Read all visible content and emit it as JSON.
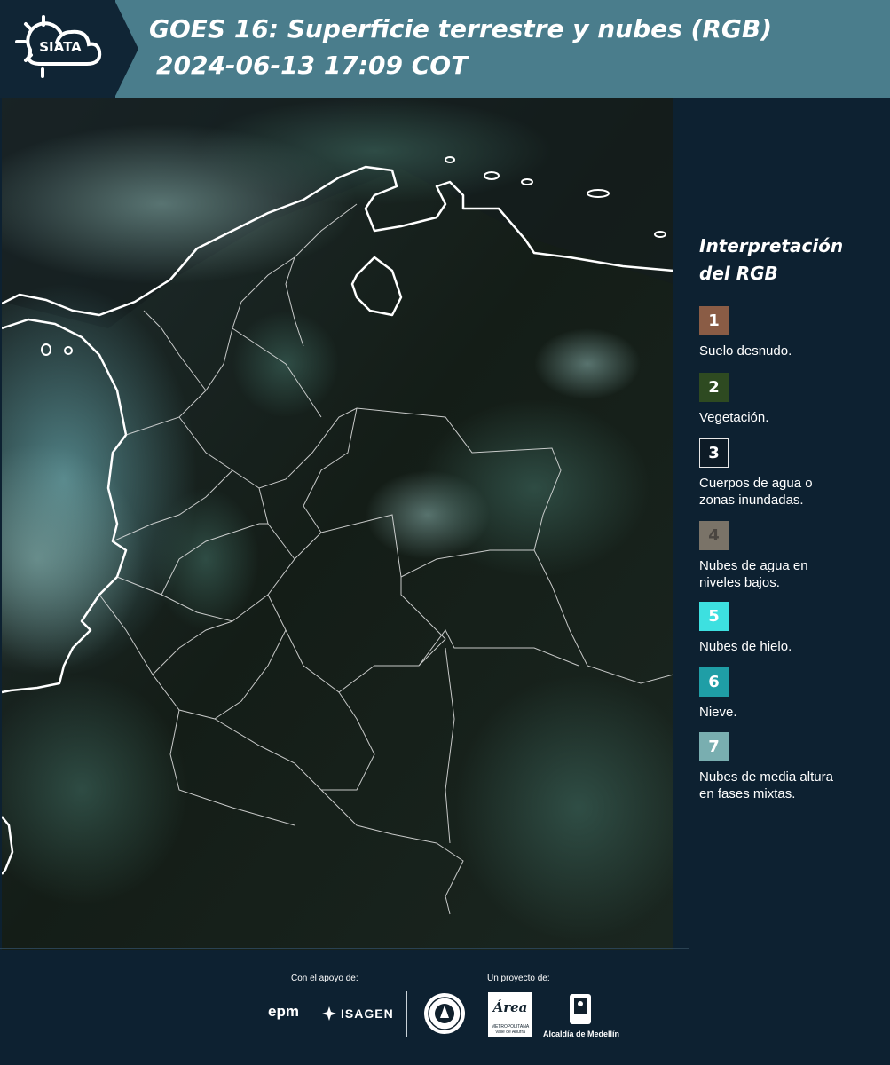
{
  "header": {
    "logo_text": "SIATA",
    "title_line1": "GOES 16: Superficie terrestre y nubes (RGB)",
    "title_line2": "2024-06-13 17:09 COT",
    "background_color": "#4a7d8c",
    "logo_background_color": "#102535"
  },
  "map": {
    "icon": "satellite-rgb-image"
  },
  "legend": {
    "title_line1": "Interpretación",
    "title_line2": "del RGB",
    "items": [
      {
        "number": "1",
        "label": "Suelo desnudo.",
        "color": "#8a5c45"
      },
      {
        "number": "2",
        "label": "Vegetación.",
        "color": "#2e4a21"
      },
      {
        "number": "3",
        "label_line1": "Cuerpos de agua o",
        "label_line2": "zonas inundadas.",
        "color": "#0d1b26"
      },
      {
        "number": "4",
        "label_line1": "Nubes de agua en",
        "label_line2": "niveles bajos.",
        "color": "#7a7368"
      },
      {
        "number": "5",
        "label": "Nubes de hielo.",
        "color": "#3de0e0"
      },
      {
        "number": "6",
        "label": "Nieve.",
        "color": "#1f9ea6"
      },
      {
        "number": "7",
        "label_line1": "Nubes de media altura",
        "label_line2": "en fases mixtas.",
        "color": "#79aeb0"
      }
    ]
  },
  "footer": {
    "support_label": "Con el apoyo de:",
    "project_label": "Un proyecto de:",
    "epm_logo_text": "epm",
    "isagen_logo_text": "ISAGEN",
    "area_logo_text": "Área",
    "area_logo_sub": "METROPOLITANA Valle de Aburrá",
    "alcaldia_text": "Alcaldía de Medellín"
  }
}
